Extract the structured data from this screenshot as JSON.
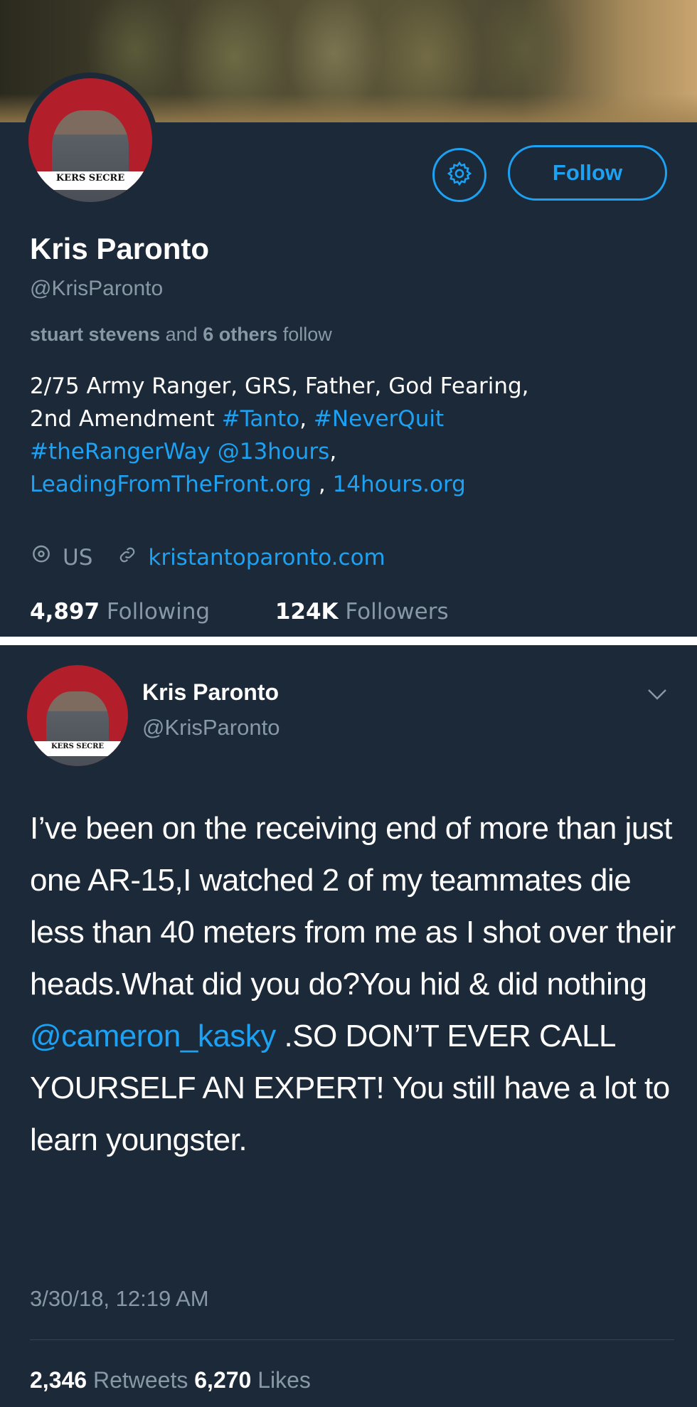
{
  "profile": {
    "name": "Kris Paronto",
    "handle": "@KrisParonto",
    "avatar_text": "KERS SECRE",
    "follow_label": "Follow",
    "followed_by": {
      "name": "stuart stevens",
      "and": "and",
      "others": "6 others",
      "suffix": "follow"
    },
    "bio": {
      "line1": "2/75 Army Ranger, GRS, Father, God Fearing,",
      "line2_text": "2nd Amendment",
      "hashtag1": "#Tanto",
      "comma1": ",",
      "hashtag2": "#NeverQuit",
      "hashtag3": "#theRangerWay",
      "mention": "@13hours",
      "comma2": ",",
      "link1": "LeadingFromTheFront.org",
      "comma3": " ,",
      "link2": "14hours.org"
    },
    "location": "US",
    "website": "kristantoparonto.com",
    "following_count": "4,897",
    "following_label": "Following",
    "followers_count": "124K",
    "followers_label": "Followers"
  },
  "tweet": {
    "name": "Kris Paronto",
    "handle": "@KrisParonto",
    "avatar_text": "KERS SECRE",
    "text_before": "I’ve been on the receiving end of more than just one AR-15,I watched 2 of my teammates die less than 40 meters from me as I shot over their heads.What did you do?You hid & did nothing",
    "mention": "@cameron_kasky",
    "text_after": ".SO DON’T EVER CALL YOURSELF AN EXPERT! You still have a lot to learn youngster.",
    "timestamp": "3/30/18, 12:19 AM",
    "retweets_count": "2,346",
    "retweets_label": "Retweets",
    "likes_count": "6,270",
    "likes_label": "Likes"
  },
  "icons": {
    "settings": "gear-icon",
    "location": "location-pin-icon",
    "website": "link-icon",
    "more": "chevron-down-icon"
  },
  "colors": {
    "background": "#1c2938",
    "accent": "#1da1f2",
    "muted": "#8899a6"
  }
}
